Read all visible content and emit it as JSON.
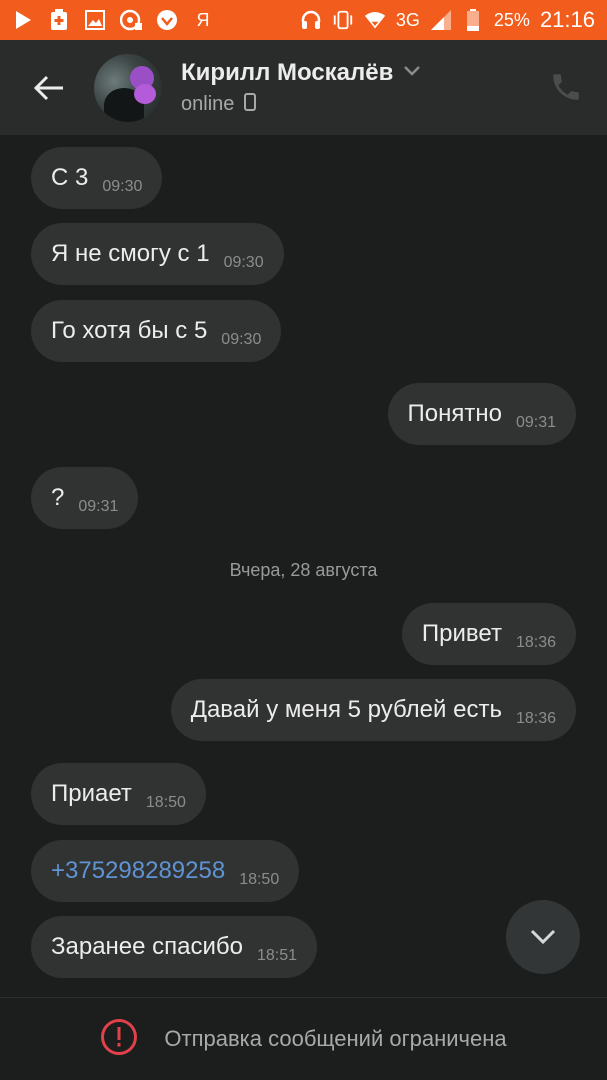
{
  "status_bar": {
    "carrier_glyph": "Я",
    "network": "3G",
    "battery": "25%",
    "time": "21:16",
    "icons": [
      "play-icon",
      "medical-plus-icon",
      "image-icon",
      "cd-icon",
      "download-app-icon",
      "headset-icon",
      "vibrate-icon",
      "wifi-icon",
      "signal-icon",
      "battery-icon"
    ]
  },
  "header": {
    "contact_name": "Кирилл Москалёв",
    "status": "online"
  },
  "messages": [
    {
      "text": "С 3",
      "time": "09:30",
      "dir": "in"
    },
    {
      "text": "Я не смогу с 1",
      "time": "09:30",
      "dir": "in"
    },
    {
      "text": "Го хотя бы с 5",
      "time": "09:30",
      "dir": "in"
    },
    {
      "text": "Понятно",
      "time": "09:31",
      "dir": "out"
    },
    {
      "text": "?",
      "time": "09:31",
      "dir": "in"
    },
    {
      "text": "Привет",
      "time": "18:36",
      "dir": "out"
    },
    {
      "text": "Давай у меня 5 рублей есть",
      "time": "18:36",
      "dir": "out"
    },
    {
      "text": "Приает",
      "time": "18:50",
      "dir": "in"
    },
    {
      "text": "+375298289258",
      "time": "18:50",
      "dir": "in",
      "is_link": true
    },
    {
      "text": "Заранее спасибо",
      "time": "18:51",
      "dir": "in"
    }
  ],
  "date_separator": "Вчера, 28 августа",
  "footer": {
    "notice": "Отправка сообщений ограничена"
  },
  "colors": {
    "status_bar": "#f25c1c",
    "header": "#2a2b2b",
    "background": "#1c1d1d",
    "bubble": "#313333",
    "link": "#5f93d3",
    "warning": "#e0414a"
  }
}
